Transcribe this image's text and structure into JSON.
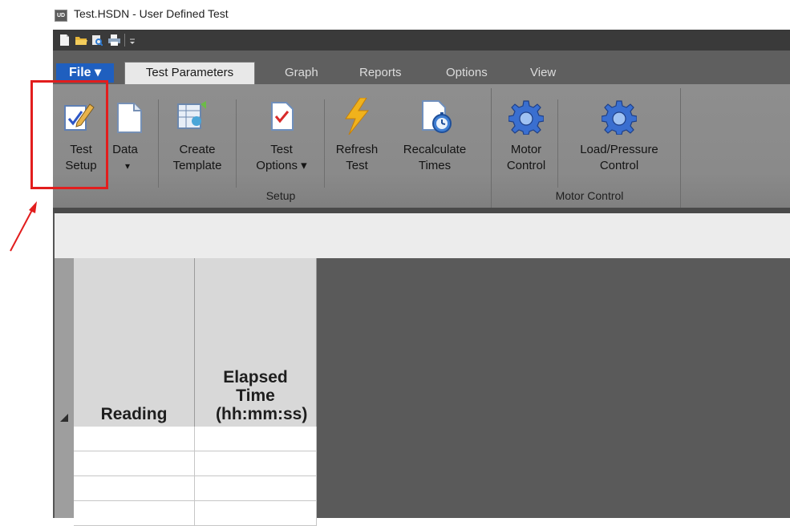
{
  "window": {
    "title": "Test.HSDN - User Defined Test",
    "app_logo_text": "UD"
  },
  "quick_access": {
    "icons": [
      "new-file-icon",
      "open-folder-icon",
      "print-preview-icon",
      "print-icon",
      "customize-toolbar-icon"
    ]
  },
  "tabs": {
    "file": "File ▾",
    "items": [
      "Test Parameters",
      "Graph",
      "Reports",
      "Options",
      "View"
    ],
    "active": "Test Parameters"
  },
  "ribbon": {
    "buttons": [
      {
        "icon": "test-setup-icon",
        "line1": "Test",
        "line2": "Setup"
      },
      {
        "icon": "data-document-icon",
        "line1": "Data",
        "line2": "▾"
      },
      {
        "icon": "create-template-icon",
        "line1": "Create",
        "line2": "Template"
      },
      {
        "icon": "test-options-icon",
        "line1": "Test",
        "line2": "Options ▾"
      },
      {
        "icon": "lightning-icon",
        "line1": "Refresh",
        "line2": "Test"
      },
      {
        "icon": "stopwatch-document-icon",
        "line1": "Recalculate",
        "line2": "Times"
      },
      {
        "icon": "gear-icon",
        "line1": "Motor",
        "line2": "Control"
      },
      {
        "icon": "gear-icon",
        "line1": "Load/Pressure",
        "line2": "Control"
      }
    ],
    "groups": [
      "Setup",
      "Motor Control"
    ]
  },
  "grid": {
    "columns": [
      {
        "label": "Reading"
      },
      {
        "label": "Elapsed Time (hh:mm:ss)"
      }
    ],
    "rows": [
      [
        "",
        ""
      ],
      [
        "",
        ""
      ],
      [
        "",
        ""
      ],
      [
        "",
        ""
      ]
    ]
  },
  "colors": {
    "highlight": "#e21d1d",
    "file_tab": "#1f5fbf",
    "ribbon": "#8a8a8a",
    "dark_panel": "#5a5a5a"
  }
}
